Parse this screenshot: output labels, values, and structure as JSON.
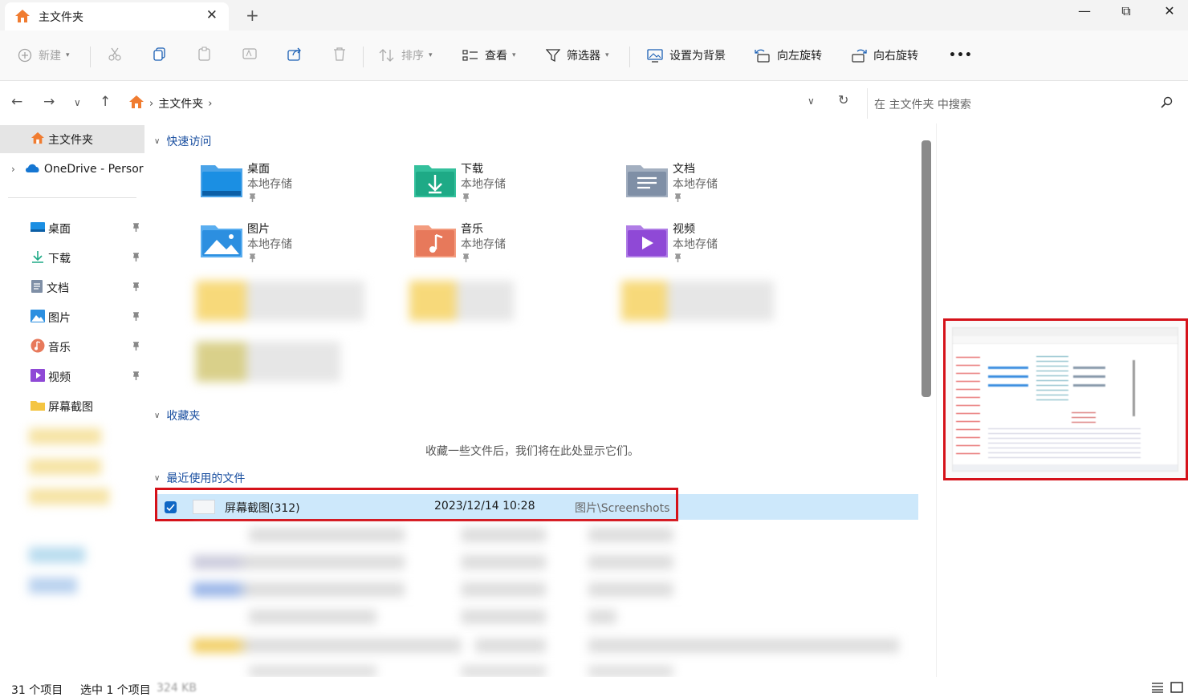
{
  "window": {
    "tab_title": "主文件夹",
    "new_tab_label": "+",
    "minimize": "—",
    "maximize": "⧉",
    "close": "✕"
  },
  "toolbar": {
    "new_label": "新建",
    "sort_label": "排序",
    "view_label": "查看",
    "filter_label": "筛选器",
    "set_background_label": "设置为背景",
    "rotate_left_label": "向左旋转",
    "rotate_right_label": "向右旋转",
    "more_label": "•••"
  },
  "address": {
    "crumbs": [
      "主文件夹"
    ],
    "search_placeholder": "在 主文件夹 中搜索"
  },
  "sidebar": {
    "home": "主文件夹",
    "onedrive": "OneDrive - Persor",
    "pinned": [
      {
        "label": "桌面",
        "icon": "desktop-icon"
      },
      {
        "label": "下载",
        "icon": "download-icon"
      },
      {
        "label": "文档",
        "icon": "documents-icon"
      },
      {
        "label": "图片",
        "icon": "pictures-icon"
      },
      {
        "label": "音乐",
        "icon": "music-icon"
      },
      {
        "label": "视频",
        "icon": "videos-icon"
      }
    ],
    "screenshots": "屏幕截图"
  },
  "quick_access": {
    "header": "快速访问",
    "tiles": [
      {
        "name": "桌面",
        "sub": "本地存储",
        "icon": "desktop-folder-icon",
        "color": "#1b8fe3"
      },
      {
        "name": "下载",
        "sub": "本地存储",
        "icon": "download-folder-icon",
        "color": "#1eaa86"
      },
      {
        "name": "文档",
        "sub": "本地存储",
        "icon": "documents-folder-icon",
        "color": "#7f8fa6"
      },
      {
        "name": "图片",
        "sub": "本地存储",
        "icon": "pictures-folder-icon",
        "color": "#2c8fe0"
      },
      {
        "name": "音乐",
        "sub": "本地存储",
        "icon": "music-folder-icon",
        "color": "#e7795b"
      },
      {
        "name": "视频",
        "sub": "本地存储",
        "icon": "videos-folder-icon",
        "color": "#8f49d6"
      }
    ]
  },
  "favorites": {
    "header": "收藏夹",
    "empty_message": "收藏一些文件后，我们将在此处显示它们。"
  },
  "recent": {
    "header": "最近使用的文件",
    "selected": {
      "name": "屏幕截图(312)",
      "date": "2023/12/14 10:28",
      "location": "图片\\Screenshots"
    }
  },
  "status": {
    "item_count": "31 个项目",
    "selected": "选中 1 个项目",
    "size": "324 KB"
  },
  "colors": {
    "accent": "#0f67c5",
    "selection": "#cde8fb",
    "highlight_box": "#d5121a"
  }
}
